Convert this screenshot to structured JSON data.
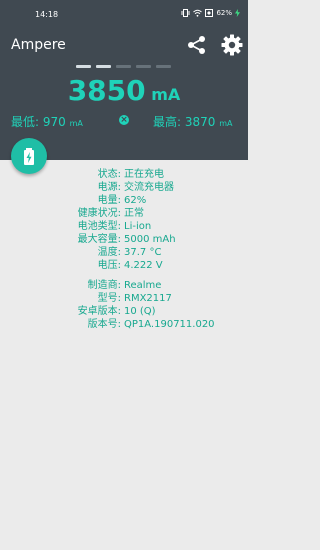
{
  "status_bar": {
    "time": "14:18",
    "battery_percent": "62%"
  },
  "app": {
    "title": "Ampere"
  },
  "current": {
    "value": "3850",
    "unit": "mA"
  },
  "min": {
    "label": "最低:",
    "value": "970",
    "unit": "mA"
  },
  "max": {
    "label": "最高:",
    "value": "3870",
    "unit": "mA"
  },
  "colors": {
    "accent": "#1fd3b9",
    "header_bg": "#404951",
    "body_bg": "#ebebeb"
  },
  "battery_info": [
    {
      "label": "状态:",
      "value": "正在充电"
    },
    {
      "label": "电源:",
      "value": "交流充电器"
    },
    {
      "label": "电量:",
      "value": "62%"
    },
    {
      "label": "健康状况:",
      "value": "正常"
    },
    {
      "label": "电池类型:",
      "value": "Li-ion"
    },
    {
      "label": "最大容量:",
      "value": "5000 mAh"
    },
    {
      "label": "温度:",
      "value": "37.7 °C"
    },
    {
      "label": "电压:",
      "value": "4.222 V"
    }
  ],
  "device_info": [
    {
      "label": "制造商:",
      "value": "Realme"
    },
    {
      "label": "型号:",
      "value": "RMX2117"
    },
    {
      "label": "安卓版本:",
      "value": "10 (Q)"
    },
    {
      "label": "版本号:",
      "value": "QP1A.190711.020"
    }
  ]
}
